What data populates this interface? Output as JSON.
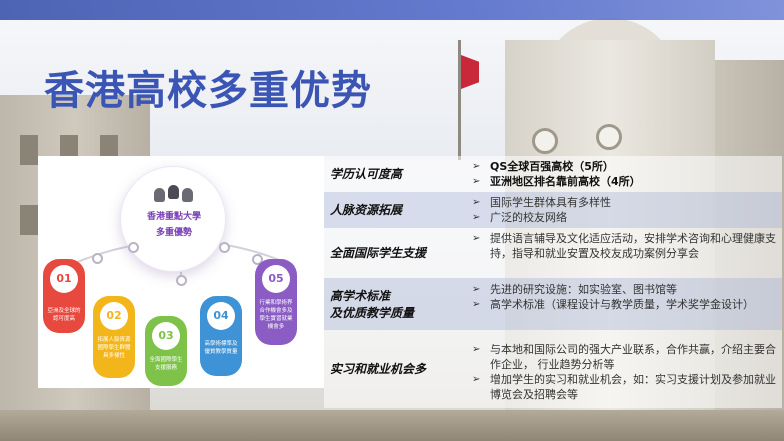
{
  "title": "香港高校多重优势",
  "infographic": {
    "center_line1": "香港重點大學",
    "center_line2": "多重優勢",
    "icon": "people-group-icon",
    "cards": [
      {
        "num": "01",
        "text": "亞洲及全球的認可度高",
        "color": "#e8493e"
      },
      {
        "num": "02",
        "text": "拓展人脈資源國際學生群體具多樣性",
        "color": "#f2b51a"
      },
      {
        "num": "03",
        "text": "全面國際學生支援服務",
        "color": "#7ec24a"
      },
      {
        "num": "04",
        "text": "高學術標準及優質教學質量",
        "color": "#3e93d6"
      },
      {
        "num": "05",
        "text": "行業和學術界合作機會多及學生實習就業機會多",
        "color": "#8a5cc4"
      }
    ]
  },
  "rows": [
    {
      "label": "学历认可度高",
      "bold": true,
      "items": [
        "QS全球百强高校（5所）",
        "亚洲地区排名靠前高校（4所）"
      ]
    },
    {
      "label": "人脉资源拓展",
      "bold": false,
      "items": [
        "国际学生群体具有多样性",
        "广泛的校友网络"
      ]
    },
    {
      "label": "全面国际学生支援",
      "bold": false,
      "items": [
        "提供语言辅导及文化适应活动，安排学术咨询和心理健康支持，指导和就业安置及校友成功案例分享会"
      ]
    },
    {
      "label": "高学术标准及优质教学质量",
      "label_line1": "高学术标准",
      "label_line2": "及优质教学质量",
      "bold": false,
      "items": [
        "先进的研究设施：如实验室、图书馆等",
        "高学术标准（课程设计与教学质量，学术奖学金设计）"
      ]
    },
    {
      "label": "实习和就业机会多",
      "bold": false,
      "items": [
        "与本地和国际公司的强大产业联系，合作共赢，介绍主要合作企业， 行业趋势分析等",
        "增加学生的实习和就业机会，如：实习支援计划及参加就业博览会及招聘会等"
      ]
    }
  ],
  "bullet_glyph": "➢",
  "colors": {
    "title": "#3a55b4",
    "band": "#cdd4e8"
  }
}
